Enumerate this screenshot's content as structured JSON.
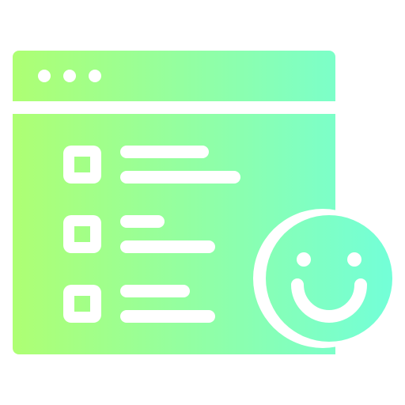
{
  "icon": {
    "name": "checklist-satisfaction-icon",
    "gradient": {
      "start": "#AEFF73",
      "end": "#73FFD8"
    },
    "background": "#FFFFFF",
    "checklist_items": 3
  }
}
